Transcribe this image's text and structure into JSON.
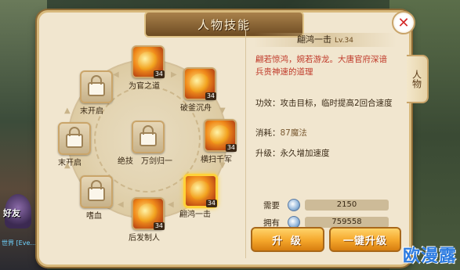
{
  "window": {
    "title": "人物技能"
  },
  "side_tab": {
    "label": "人物"
  },
  "scene": {
    "friend_label": "好友",
    "chat_text": "世界 [Eve..."
  },
  "watermark": "欧漫露",
  "skills": [
    {
      "name": "为官之道",
      "status": "learned",
      "level": "34",
      "icon": "official-skill-icon"
    },
    {
      "name": "破釜沉舟",
      "status": "learned",
      "level": "34",
      "icon": "fire-slash-icon"
    },
    {
      "name": "横扫千军",
      "status": "learned",
      "level": "34",
      "icon": "sweep-blade-icon"
    },
    {
      "name": "翩鸿一击",
      "status": "learned",
      "level": "34",
      "icon": "strike-icon"
    },
    {
      "name": "后发制人",
      "status": "learned",
      "level": "34",
      "icon": "counter-icon"
    },
    {
      "name": "嗜血",
      "status": "locked",
      "level": "",
      "icon": "lock-icon"
    },
    {
      "name": "末开启",
      "status": "locked",
      "level": "",
      "icon": "lock-icon"
    },
    {
      "name": "末开启",
      "status": "locked",
      "level": "",
      "icon": "lock-icon"
    },
    {
      "name": "绝技",
      "status": "locked",
      "level": "",
      "icon": "lock-icon"
    },
    {
      "name": "万剑归一",
      "status": "locked",
      "level": "",
      "icon": "lock-icon"
    }
  ],
  "detail": {
    "skill_name": "翩鸿一击",
    "level_text": "Lv.34",
    "description": "翩若惊鸿，婉若游龙。大唐官府深谙兵贵神速的道理",
    "effect_label": "功效：",
    "effect_text": "攻击目标，临时提高2回合速度",
    "cost_label": "消耗：",
    "cost_text": "87魔法",
    "upgrade_label": "升级：",
    "upgrade_text": "永久增加速度",
    "need_label": "需要",
    "need_value": "2150",
    "have_label": "拥有",
    "have_value": "759558"
  },
  "buttons": {
    "upgrade": "升 级",
    "upgrade_all": "一键升级"
  },
  "colors": {
    "accent": "#f4a62a",
    "frame": "#d8b97c",
    "desc_red": "#c03a2a"
  }
}
